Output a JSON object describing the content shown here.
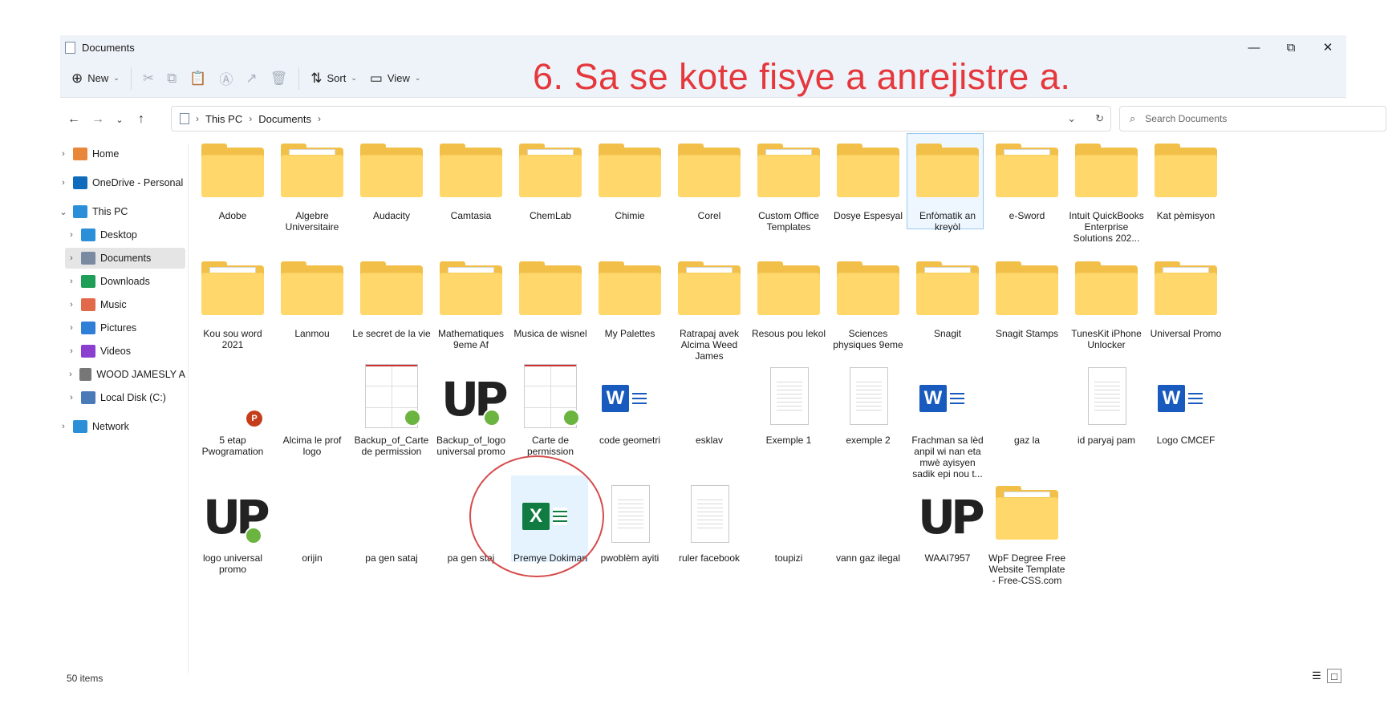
{
  "window": {
    "title": "Documents",
    "minimize": "—",
    "maximize": "⧉",
    "close": "✕"
  },
  "toolbar": {
    "new_label": "New",
    "sort_label": "Sort",
    "view_label": "View",
    "icons": [
      "cut-icon",
      "copy-icon",
      "paste-icon",
      "rename-icon",
      "share-icon",
      "delete-icon"
    ]
  },
  "annotation": "6. Sa se kote fisye a anrejistre a.",
  "address": {
    "crumbs": [
      "This PC",
      "Documents"
    ],
    "separator": "›"
  },
  "search": {
    "placeholder": "Search Documents"
  },
  "sidebar": {
    "items": [
      {
        "label": "Home",
        "icon": "home-icon",
        "color": "#e8863a"
      },
      {
        "label": "OneDrive - Personal",
        "icon": "cloud-icon",
        "color": "#0f6cbd"
      },
      {
        "label": "This PC",
        "icon": "computer-icon",
        "color": "#2a8fd8"
      },
      {
        "label": "Desktop",
        "icon": "desktop-icon",
        "color": "#2a8fd8"
      },
      {
        "label": "Documents",
        "icon": "documents-icon",
        "color": "#7a8aa0"
      },
      {
        "label": "Downloads",
        "icon": "download-icon",
        "color": "#1f9e57"
      },
      {
        "label": "Music",
        "icon": "music-icon",
        "color": "#e06a4a"
      },
      {
        "label": "Pictures",
        "icon": "pictures-icon",
        "color": "#2f7fd6"
      },
      {
        "label": "Videos",
        "icon": "videos-icon",
        "color": "#8a3fd1"
      },
      {
        "label": "WOOD JAMESLY A",
        "icon": "drive-icon",
        "color": "#777777"
      },
      {
        "label": "Local Disk (C:)",
        "icon": "disk-icon",
        "color": "#4a7bb8"
      },
      {
        "label": "Network",
        "icon": "network-icon",
        "color": "#2a8fd8"
      }
    ]
  },
  "files": [
    {
      "name": "Adobe",
      "kind": "folder"
    },
    {
      "name": "Algebre Universitaire",
      "kind": "folder"
    },
    {
      "name": "Audacity",
      "kind": "folder"
    },
    {
      "name": "Camtasia",
      "kind": "folder"
    },
    {
      "name": "ChemLab",
      "kind": "folder"
    },
    {
      "name": "Chimie",
      "kind": "folder"
    },
    {
      "name": "Corel",
      "kind": "folder"
    },
    {
      "name": "Custom Office Templates",
      "kind": "folder"
    },
    {
      "name": "Dosye Espesyal",
      "kind": "folder"
    },
    {
      "name": "Enfòmatik an kreyòl",
      "kind": "folder"
    },
    {
      "name": "e-Sword",
      "kind": "folder"
    },
    {
      "name": "Intuit QuickBooks Enterprise Solutions 202...",
      "kind": "folder"
    },
    {
      "name": "Kat pèmisyon",
      "kind": "folder"
    },
    {
      "name": "Kou sou word 2021",
      "kind": "folder"
    },
    {
      "name": "Lanmou",
      "kind": "folder"
    },
    {
      "name": "Le secret de la vie",
      "kind": "folder"
    },
    {
      "name": "Mathematiques 9eme Af",
      "kind": "folder"
    },
    {
      "name": "Musica de wisnel",
      "kind": "folder"
    },
    {
      "name": "My Palettes",
      "kind": "folder"
    },
    {
      "name": "Ratrapaj avek Alcima Weed James",
      "kind": "folder"
    },
    {
      "name": "Resous pou lekol",
      "kind": "folder"
    },
    {
      "name": "Sciences physiques 9eme",
      "kind": "folder"
    },
    {
      "name": "Snagit",
      "kind": "folder"
    },
    {
      "name": "Snagit Stamps",
      "kind": "folder"
    },
    {
      "name": "TunesKit iPhone Unlocker",
      "kind": "folder"
    },
    {
      "name": "Universal Promo",
      "kind": "folder"
    },
    {
      "name": "5 etap Pwogramation",
      "kind": "ppt"
    },
    {
      "name": "Alcima le prof logo",
      "kind": "image"
    },
    {
      "name": "Backup_of_Carte de permission",
      "kind": "card"
    },
    {
      "name": "Backup_of_logo universal promo",
      "kind": "up"
    },
    {
      "name": "Carte de permission",
      "kind": "card"
    },
    {
      "name": "code geometri",
      "kind": "word"
    },
    {
      "name": "esklav",
      "kind": "image"
    },
    {
      "name": "Exemple 1",
      "kind": "doc"
    },
    {
      "name": "exemple 2",
      "kind": "doc"
    },
    {
      "name": "Frachman sa lèd anpil wi nan eta mwè ayisyen sadik epi nou t...",
      "kind": "word"
    },
    {
      "name": "gaz la",
      "kind": "image"
    },
    {
      "name": "id paryaj pam",
      "kind": "doc"
    },
    {
      "name": "Logo CMCEF",
      "kind": "word"
    },
    {
      "name": "logo universal promo",
      "kind": "up"
    },
    {
      "name": "orijin",
      "kind": "image"
    },
    {
      "name": "pa gen sataj",
      "kind": "image"
    },
    {
      "name": "pa gen staj",
      "kind": "image"
    },
    {
      "name": "Premye Dokiman",
      "kind": "excel"
    },
    {
      "name": "pwoblèm ayiti",
      "kind": "doc"
    },
    {
      "name": "ruler facebook",
      "kind": "doc"
    },
    {
      "name": "toupizi",
      "kind": "image"
    },
    {
      "name": "vann gaz ilegal",
      "kind": "image"
    },
    {
      "name": "WAAI7957",
      "kind": "up"
    },
    {
      "name": "WpF Degree Free Website Template - Free-CSS.com",
      "kind": "folder"
    }
  ],
  "status": {
    "count": "50 items"
  }
}
